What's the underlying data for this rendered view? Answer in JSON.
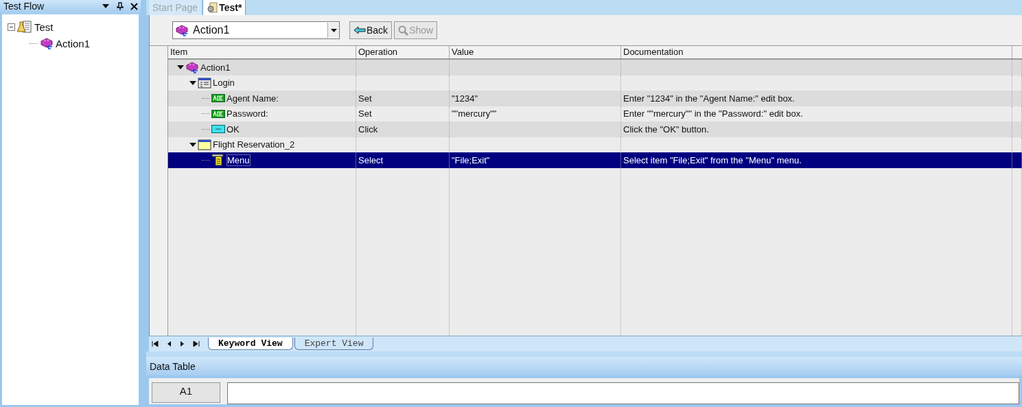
{
  "test_flow": {
    "title": "Test Flow",
    "tree": [
      {
        "label": "Test",
        "kind": "test",
        "expanded": true,
        "children": [
          {
            "label": "Action1",
            "kind": "action"
          }
        ]
      }
    ]
  },
  "document_tabs": [
    {
      "label": "Start Page",
      "selected": false
    },
    {
      "label": "Test*",
      "selected": true
    }
  ],
  "toolbar": {
    "action_select": "Action1",
    "buttons": [
      {
        "label": "Back",
        "kind": "back",
        "disabled": false
      },
      {
        "label": "Show",
        "kind": "show",
        "disabled": true
      }
    ]
  },
  "grid": {
    "columns": [
      "Item",
      "Operation",
      "Value",
      "Documentation"
    ],
    "rows": [
      {
        "item": "Action1",
        "kind": "action",
        "expanded": true,
        "selected": false,
        "children": [
          {
            "item": "Login",
            "kind": "dialog",
            "expanded": true,
            "selected": false,
            "children": [
              {
                "item": "Agent Name:",
                "kind": "edit",
                "selected": false,
                "operation": "Set",
                "value": "\"1234\"",
                "documentation": "Enter \"1234\" in the \"Agent Name:\" edit box."
              },
              {
                "item": "Password:",
                "kind": "edit",
                "selected": false,
                "operation": "Set",
                "value": "\"\"mercury\"\"",
                "documentation": "Enter \"\"mercury\"\" in the \"Password:\" edit box."
              },
              {
                "item": "OK",
                "kind": "button",
                "selected": false,
                "operation": "Click",
                "documentation": "Click the \"OK\" button."
              }
            ]
          },
          {
            "item": "Flight Reservation_2",
            "kind": "window",
            "expanded": true,
            "selected": false,
            "children": [
              {
                "item": "Menu",
                "kind": "menu",
                "selected": true,
                "operation": "Select",
                "value": "\"File;Exit\"",
                "documentation": "Select item \"File;Exit\" from the \"Menu\" menu."
              }
            ]
          }
        ]
      }
    ]
  },
  "view_tabs": [
    {
      "label": "Keyword View",
      "selected": true
    },
    {
      "label": "Expert View",
      "selected": false
    }
  ],
  "data_table": {
    "title": "Data Table",
    "cell_name": "A1"
  }
}
